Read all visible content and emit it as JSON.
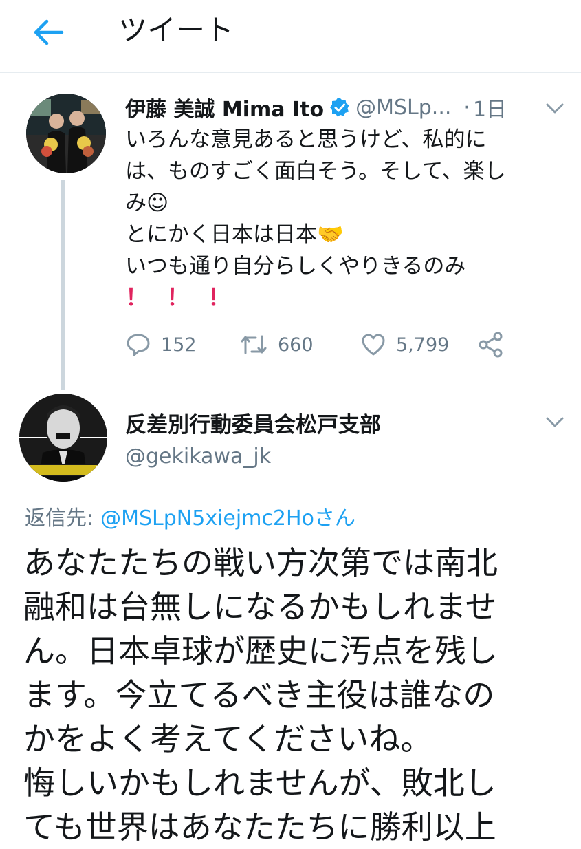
{
  "header": {
    "title": "ツイート"
  },
  "tweet1": {
    "name": "伊藤 美誠 Mima Ito",
    "handle": "@MSLp...",
    "dot": "·",
    "time": "1日",
    "lines": [
      "いろんな意見あると思うけど、私的に",
      "は、ものすごく面白そう。そして、楽し",
      "み☺",
      "とにかく日本は日本🤝",
      "いつも通り自分らしくやりきるのみ"
    ],
    "exclamations": [
      "！",
      "！",
      "！"
    ],
    "replies": "152",
    "retweets": "660",
    "likes": "5,799"
  },
  "tweet2": {
    "name": "反差別行動委員会松戸支部",
    "handle": "@gekikawa_jk",
    "replying_label": "返信先:",
    "replying_to": "@MSLpN5xiejmc2Hoさん",
    "lines": [
      "あなたたちの戦い方次第では南北",
      "融和は台無しになるかもしれませ",
      "ん。日本卓球が歴史に汚点を残し",
      "ます。今立てるべき主役は誰なの",
      "かをよく考えてくださいね。",
      "悔しいかもしれませんが、敗北し",
      "ても世界はあなたたちに勝利以上"
    ]
  },
  "colors": {
    "accent": "#1da1f2",
    "secondary_text": "#657786",
    "divider": "#e6ecf0",
    "exclaim": "#e0245e"
  },
  "icons": [
    "back-arrow-icon",
    "verified-badge-icon",
    "chevron-down-icon",
    "reply-icon",
    "retweet-icon",
    "like-icon",
    "share-icon"
  ]
}
